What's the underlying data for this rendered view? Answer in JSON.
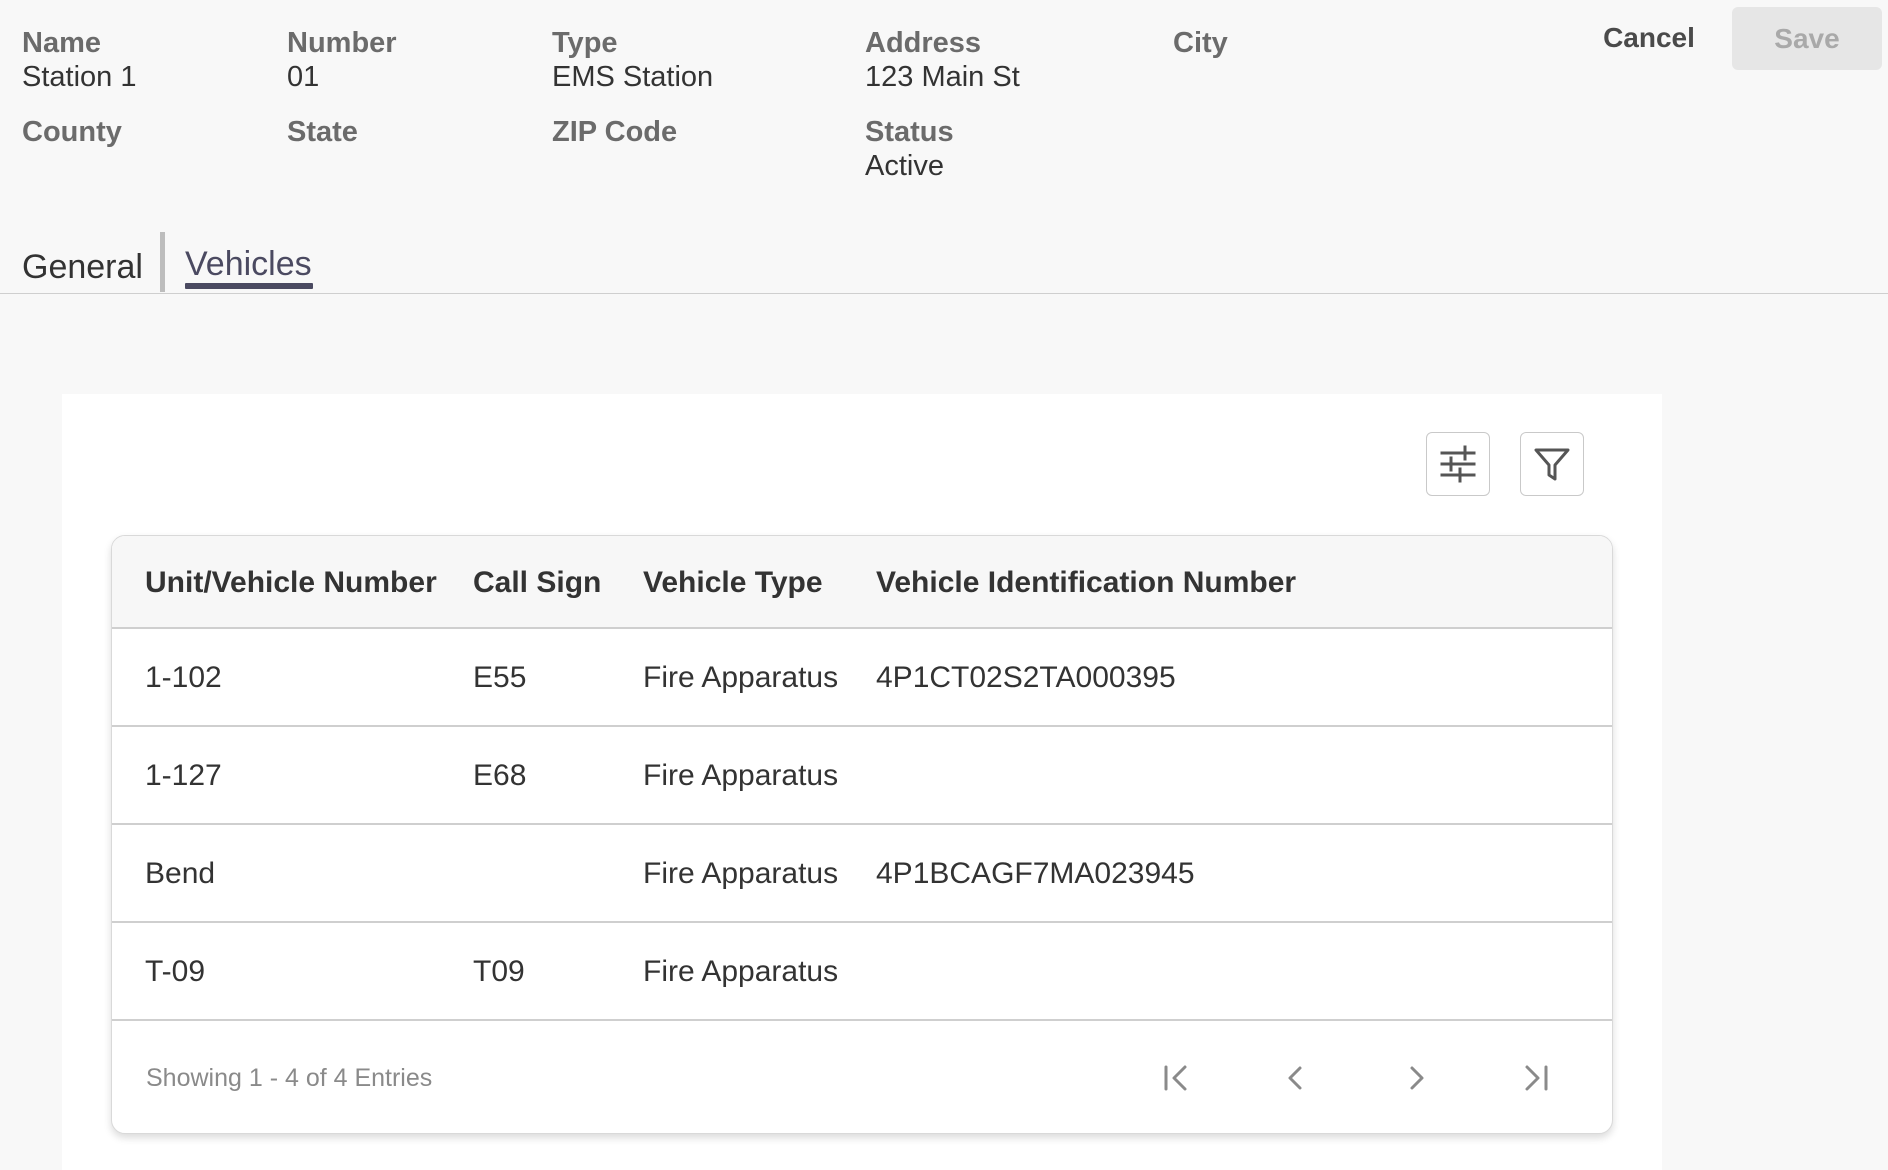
{
  "header": {
    "fields": [
      {
        "label": "Name",
        "value": "Station 1"
      },
      {
        "label": "Number",
        "value": "01"
      },
      {
        "label": "Type",
        "value": "EMS Station"
      },
      {
        "label": "Address",
        "value": "123 Main St"
      },
      {
        "label": "City",
        "value": ""
      },
      {
        "label": "County",
        "value": ""
      },
      {
        "label": "State",
        "value": ""
      },
      {
        "label": "ZIP Code",
        "value": ""
      },
      {
        "label": "Status",
        "value": "Active"
      }
    ],
    "cancel_label": "Cancel",
    "save_label": "Save"
  },
  "tabs": [
    {
      "label": "General",
      "active": false
    },
    {
      "label": "Vehicles",
      "active": true
    }
  ],
  "toolbar": {
    "columns_icon": "sliders-icon",
    "filter_icon": "filter-icon"
  },
  "table": {
    "headers": [
      "Unit/Vehicle Number",
      "Call Sign",
      "Vehicle Type",
      "Vehicle Identification Number"
    ],
    "rows": [
      [
        "1-102",
        "E55",
        "Fire Apparatus",
        "4P1CT02S2TA000395"
      ],
      [
        "1-127",
        "E68",
        "Fire Apparatus",
        ""
      ],
      [
        "Bend",
        "",
        "Fire Apparatus",
        "4P1BCAGF7MA023945"
      ],
      [
        "T-09",
        "T09",
        "Fire Apparatus",
        ""
      ]
    ],
    "footer_text": "Showing 1 - 4 of 4 Entries"
  },
  "colors": {
    "accent": "#4b4a61",
    "save_disabled_bg": "#e6e6e6",
    "label_gray": "#6b6b6b"
  }
}
